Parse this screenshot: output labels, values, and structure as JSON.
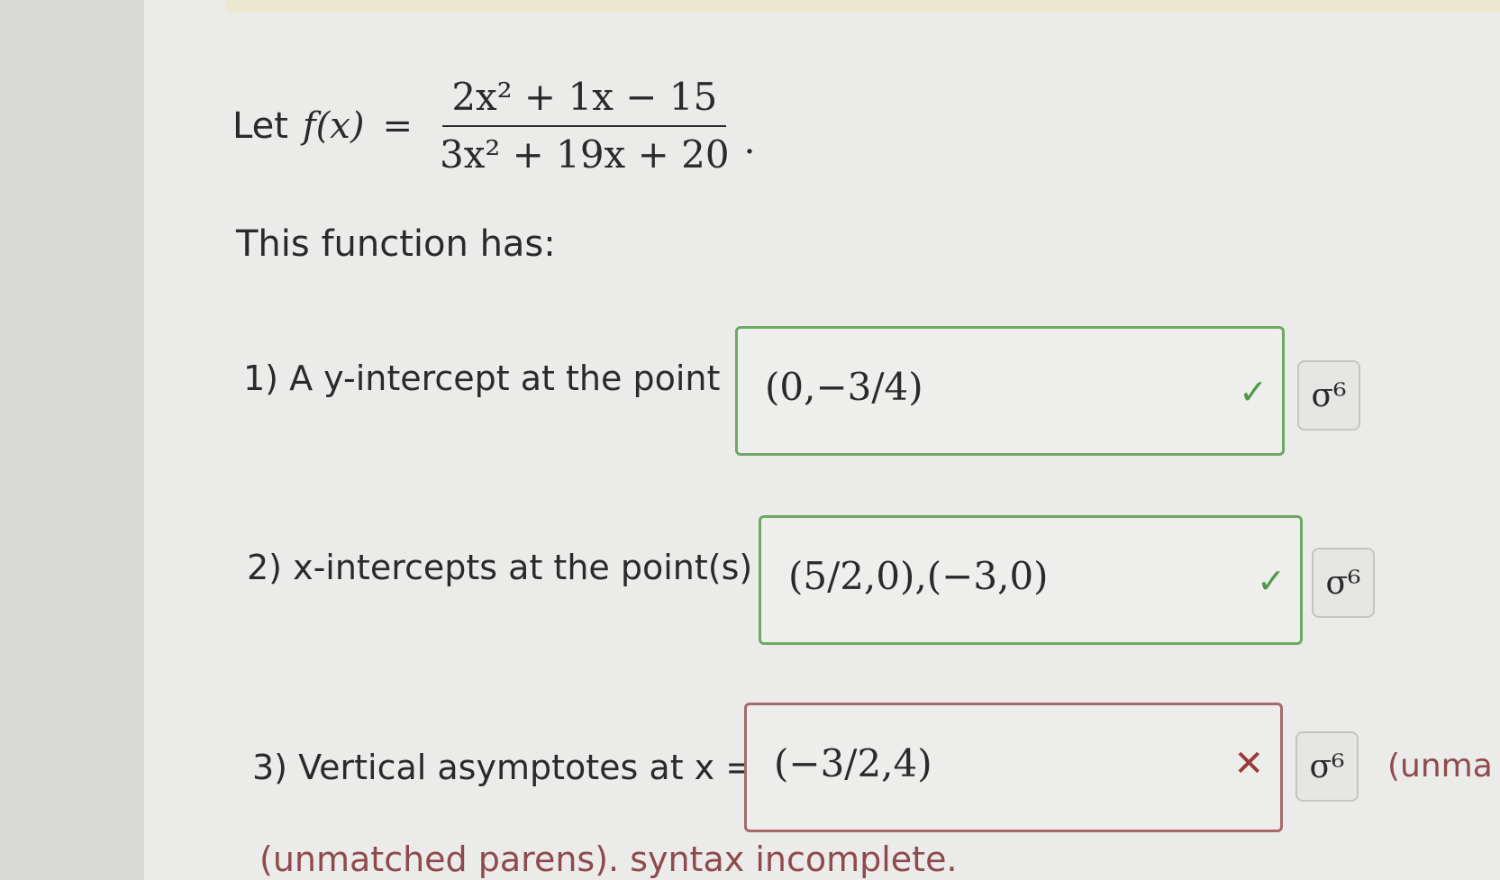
{
  "problem": {
    "prefix": "Let",
    "function_name": "f(x)",
    "equals": "=",
    "numerator": "2x² + 1x − 15",
    "denominator": "3x² + 19x + 20",
    "suffix": "."
  },
  "intro_text": "This function has:",
  "rows": [
    {
      "label": "1) A y-intercept at the point",
      "answer": "(0,−3/4)",
      "status": "correct",
      "status_glyph": "✓",
      "keyboard_glyph": "σ⁶"
    },
    {
      "label": "2) x-intercepts at the point(s)",
      "answer": "(5/2,0),(−3,0)",
      "status": "correct",
      "status_glyph": "✓",
      "keyboard_glyph": "σ⁶"
    },
    {
      "label": "3) Vertical asymptotes at x =",
      "answer": "(−3/2,4)",
      "status": "incorrect",
      "status_glyph": "✕",
      "keyboard_glyph": "σ⁶"
    }
  ],
  "inline_error": "(unma",
  "error_message": "(unmatched parens). syntax incomplete.",
  "colors": {
    "correct": "#4f9b47",
    "incorrect": "#9a3a3b",
    "error_text": "#8f4a4d"
  },
  "icons": {
    "correct": "check-icon",
    "incorrect": "x-icon",
    "keyboard": "math-keyboard-icon"
  }
}
